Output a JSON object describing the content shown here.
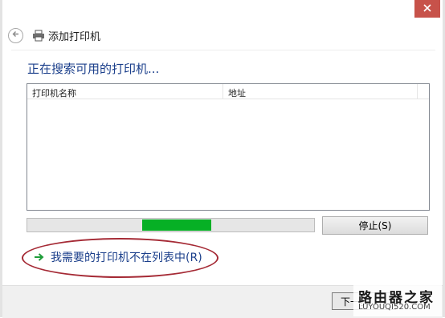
{
  "window": {
    "title": "添加打印机",
    "heading": "正在搜索可用的打印机...",
    "colors": {
      "accent": "#1b3f8b",
      "progress": "#06b025",
      "close": "#c7524a",
      "highlight": "#a52a35"
    }
  },
  "listview": {
    "columns": [
      "打印机名称",
      "地址"
    ],
    "rows": []
  },
  "progress": {
    "fill_start": 0.4,
    "fill_end": 0.64
  },
  "buttons": {
    "stop": "停止(S)",
    "next": "下一步"
  },
  "link": {
    "label": "我需要的打印机不在列表中(R)"
  },
  "watermark": {
    "line1": "路由器之家",
    "line2": "LUYOUQI520.COM"
  },
  "icons": {
    "close": "close-icon",
    "back": "back-arrow-icon",
    "printer": "printer-icon",
    "link_arrow": "green-arrow-icon"
  }
}
